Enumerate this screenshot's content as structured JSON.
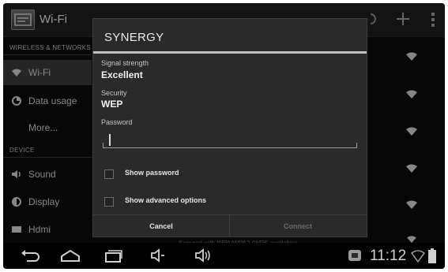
{
  "actionbar": {
    "title": "Wi-Fi",
    "icons": [
      "wps-icon",
      "add-network-icon",
      "overflow-menu-icon"
    ]
  },
  "sidebar": {
    "sections": [
      {
        "header": "WIRELESS & NETWORKS"
      },
      {
        "header": "DEVICE"
      }
    ],
    "items": [
      {
        "label": "Wi-Fi",
        "icon": "wifi-icon"
      },
      {
        "label": "Data usage",
        "icon": "data-usage-icon"
      },
      {
        "label": "More...",
        "icon": ""
      },
      {
        "label": "Sound",
        "icon": "sound-icon"
      },
      {
        "label": "Display",
        "icon": "display-icon"
      },
      {
        "label": "Hdmi",
        "icon": "hdmi-icon"
      }
    ]
  },
  "background_footer": "Secured with WPA/WPA2 (WPS available)",
  "dialog": {
    "title": "SYNERGY",
    "signal_label": "Signal strength",
    "signal_value": "Excellent",
    "security_label": "Security",
    "security_value": "WEP",
    "password_label": "Password",
    "password_value": "",
    "show_password": {
      "label": "Show password",
      "checked": false
    },
    "show_advanced": {
      "label": "Show advanced options",
      "checked": false
    },
    "cancel_label": "Cancel",
    "connect_label": "Connect"
  },
  "navbar": {
    "icons": [
      "back-icon",
      "home-icon",
      "recent-apps-icon",
      "volume-down-icon",
      "volume-up-icon",
      "usb-debug-icon",
      "wifi-status-icon",
      "battery-icon"
    ],
    "time": "11:12"
  },
  "colors": {
    "background": "#0c0c0c",
    "dialog": "#2a2a2a",
    "accent_rule": "#bcbcbc"
  }
}
